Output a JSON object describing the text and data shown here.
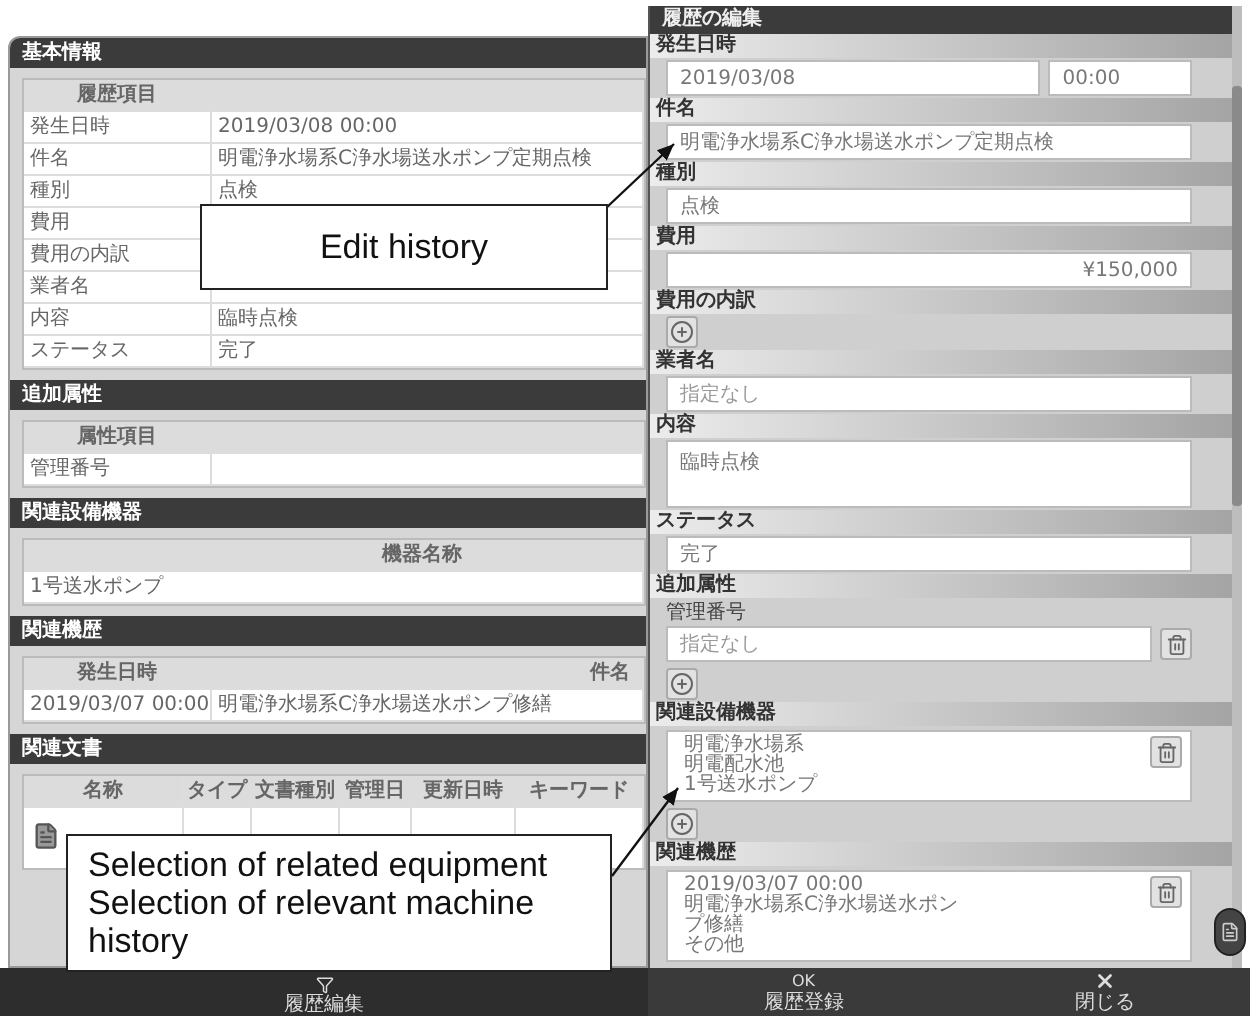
{
  "basic_info": {
    "title": "基本情報",
    "header": "履歴項目",
    "rows": [
      {
        "label": "発生日時",
        "value": "2019/03/08 00:00"
      },
      {
        "label": "件名",
        "value": "明電浄水場系C浄水場送水ポンプ定期点検"
      },
      {
        "label": "種別",
        "value": "点検"
      },
      {
        "label": "費用"
      },
      {
        "label": "費用の内訳"
      },
      {
        "label": "業者名"
      },
      {
        "label": "内容",
        "value": "臨時点検"
      },
      {
        "label": "ステータス",
        "value": "完了"
      }
    ]
  },
  "additional_attributes": {
    "title": "追加属性",
    "header": "属性項目",
    "rows": [
      {
        "label": "管理番号"
      }
    ]
  },
  "related_equipment": {
    "title": "関連設備機器",
    "header": "機器名称",
    "rows": [
      "1号送水ポンプ"
    ]
  },
  "related_history": {
    "title": "関連機歴",
    "columns": [
      "発生日時",
      "件名"
    ],
    "rows": [
      [
        "2019/03/07 00:00",
        "明電浄水場系C浄水場送水ポンプ修繕"
      ]
    ]
  },
  "related_documents": {
    "title": "関連文書",
    "columns": [
      "名称",
      "タイプ",
      "文書種別",
      "管理日",
      "更新日時",
      "キーワード"
    ],
    "rows": [
      {
        "kind": "file"
      }
    ]
  },
  "left_toolbar": {
    "button": "履歴編集"
  },
  "edit_panel": {
    "title": "履歴の編集",
    "fields": [
      {
        "kind": "datetime",
        "label": "発生日時",
        "date": "2019/03/08",
        "time": "00:00"
      },
      {
        "kind": "text",
        "label": "件名",
        "value": "明電浄水場系C浄水場送水ポンプ定期点検"
      },
      {
        "kind": "text",
        "label": "種別",
        "value": "点検"
      },
      {
        "kind": "amount",
        "label": "費用",
        "value": "¥150,000"
      },
      {
        "kind": "add",
        "label": "費用の内訳"
      },
      {
        "kind": "text",
        "label": "業者名",
        "placeholder": "指定なし"
      },
      {
        "kind": "textarea",
        "label": "内容",
        "value": "臨時点検"
      },
      {
        "kind": "text",
        "label": "ステータス",
        "value": "完了"
      },
      {
        "kind": "attributes",
        "label": "追加属性",
        "items": [
          {
            "name": "管理番号",
            "placeholder": "指定なし"
          }
        ]
      },
      {
        "kind": "list",
        "label": "関連設備機器",
        "addable": true,
        "items": [
          {
            "lines": [
              "明電浄水場系",
              "明電配水池",
              "1号送水ポンプ"
            ]
          }
        ]
      },
      {
        "kind": "list",
        "label": "関連機歴",
        "addable": false,
        "items": [
          {
            "lines": [
              "2019/03/07 00:00",
              "明電浄水場系C浄水場送水ポン",
              "プ修繕",
              "その他"
            ]
          }
        ]
      }
    ]
  },
  "actions": [
    {
      "kind": "ok",
      "mark": "OK",
      "label": "履歴登録"
    },
    {
      "kind": "close",
      "label": "閉じる"
    }
  ],
  "callouts": [
    {
      "lines": [
        "Edit history"
      ]
    },
    {
      "lines": [
        "Selection of related equipment",
        "Selection of relevant machine history"
      ]
    }
  ]
}
